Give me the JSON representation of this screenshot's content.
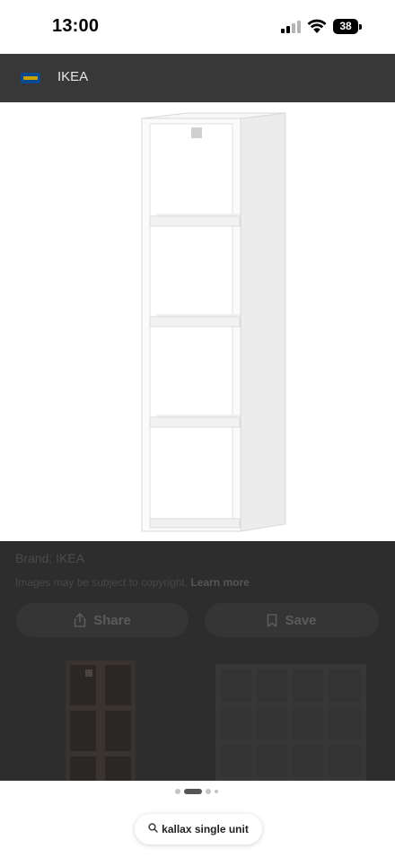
{
  "status_bar": {
    "time": "13:00",
    "battery": "38",
    "icons": [
      "cellular-signal-icon",
      "wifi-icon",
      "battery-icon"
    ]
  },
  "header": {
    "site_name": "IKEA",
    "logo_icon": "ikea-logo-icon"
  },
  "image": {
    "subject": "white four-cube shelving unit",
    "background": "#ffffff"
  },
  "info": {
    "brand": "Brand: IKEA",
    "copyright": "Images may be subject to copyright.",
    "learn_more": "Learn more"
  },
  "actions": {
    "share_label": "Share",
    "share_icon": "share-icon",
    "save_label": "Save",
    "save_icon": "bookmark-icon"
  },
  "related": {
    "items": [
      "dark shelving unit",
      "white shelving unit"
    ]
  },
  "carousel": {
    "dot_count": 4,
    "active_index": 1
  },
  "search": {
    "query": "kallax single unit",
    "icon": "search-icon"
  },
  "colors": {
    "overlay": "#2d2d2d",
    "header": "#383838",
    "pill": "#353535"
  }
}
